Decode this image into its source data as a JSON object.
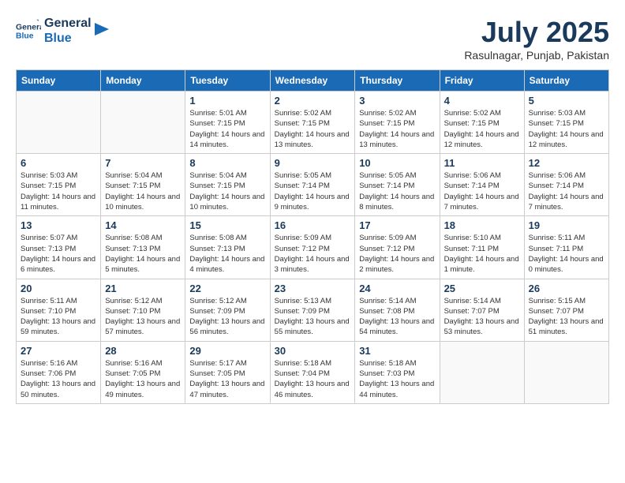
{
  "header": {
    "logo_general": "General",
    "logo_blue": "Blue",
    "month": "July 2025",
    "location": "Rasulnagar, Punjab, Pakistan"
  },
  "weekdays": [
    "Sunday",
    "Monday",
    "Tuesday",
    "Wednesday",
    "Thursday",
    "Friday",
    "Saturday"
  ],
  "weeks": [
    [
      {
        "day": null
      },
      {
        "day": null
      },
      {
        "day": 1,
        "sunrise": "Sunrise: 5:01 AM",
        "sunset": "Sunset: 7:15 PM",
        "daylight": "Daylight: 14 hours and 14 minutes."
      },
      {
        "day": 2,
        "sunrise": "Sunrise: 5:02 AM",
        "sunset": "Sunset: 7:15 PM",
        "daylight": "Daylight: 14 hours and 13 minutes."
      },
      {
        "day": 3,
        "sunrise": "Sunrise: 5:02 AM",
        "sunset": "Sunset: 7:15 PM",
        "daylight": "Daylight: 14 hours and 13 minutes."
      },
      {
        "day": 4,
        "sunrise": "Sunrise: 5:02 AM",
        "sunset": "Sunset: 7:15 PM",
        "daylight": "Daylight: 14 hours and 12 minutes."
      },
      {
        "day": 5,
        "sunrise": "Sunrise: 5:03 AM",
        "sunset": "Sunset: 7:15 PM",
        "daylight": "Daylight: 14 hours and 12 minutes."
      }
    ],
    [
      {
        "day": 6,
        "sunrise": "Sunrise: 5:03 AM",
        "sunset": "Sunset: 7:15 PM",
        "daylight": "Daylight: 14 hours and 11 minutes."
      },
      {
        "day": 7,
        "sunrise": "Sunrise: 5:04 AM",
        "sunset": "Sunset: 7:15 PM",
        "daylight": "Daylight: 14 hours and 10 minutes."
      },
      {
        "day": 8,
        "sunrise": "Sunrise: 5:04 AM",
        "sunset": "Sunset: 7:15 PM",
        "daylight": "Daylight: 14 hours and 10 minutes."
      },
      {
        "day": 9,
        "sunrise": "Sunrise: 5:05 AM",
        "sunset": "Sunset: 7:14 PM",
        "daylight": "Daylight: 14 hours and 9 minutes."
      },
      {
        "day": 10,
        "sunrise": "Sunrise: 5:05 AM",
        "sunset": "Sunset: 7:14 PM",
        "daylight": "Daylight: 14 hours and 8 minutes."
      },
      {
        "day": 11,
        "sunrise": "Sunrise: 5:06 AM",
        "sunset": "Sunset: 7:14 PM",
        "daylight": "Daylight: 14 hours and 7 minutes."
      },
      {
        "day": 12,
        "sunrise": "Sunrise: 5:06 AM",
        "sunset": "Sunset: 7:14 PM",
        "daylight": "Daylight: 14 hours and 7 minutes."
      }
    ],
    [
      {
        "day": 13,
        "sunrise": "Sunrise: 5:07 AM",
        "sunset": "Sunset: 7:13 PM",
        "daylight": "Daylight: 14 hours and 6 minutes."
      },
      {
        "day": 14,
        "sunrise": "Sunrise: 5:08 AM",
        "sunset": "Sunset: 7:13 PM",
        "daylight": "Daylight: 14 hours and 5 minutes."
      },
      {
        "day": 15,
        "sunrise": "Sunrise: 5:08 AM",
        "sunset": "Sunset: 7:13 PM",
        "daylight": "Daylight: 14 hours and 4 minutes."
      },
      {
        "day": 16,
        "sunrise": "Sunrise: 5:09 AM",
        "sunset": "Sunset: 7:12 PM",
        "daylight": "Daylight: 14 hours and 3 minutes."
      },
      {
        "day": 17,
        "sunrise": "Sunrise: 5:09 AM",
        "sunset": "Sunset: 7:12 PM",
        "daylight": "Daylight: 14 hours and 2 minutes."
      },
      {
        "day": 18,
        "sunrise": "Sunrise: 5:10 AM",
        "sunset": "Sunset: 7:11 PM",
        "daylight": "Daylight: 14 hours and 1 minute."
      },
      {
        "day": 19,
        "sunrise": "Sunrise: 5:11 AM",
        "sunset": "Sunset: 7:11 PM",
        "daylight": "Daylight: 14 hours and 0 minutes."
      }
    ],
    [
      {
        "day": 20,
        "sunrise": "Sunrise: 5:11 AM",
        "sunset": "Sunset: 7:10 PM",
        "daylight": "Daylight: 13 hours and 59 minutes."
      },
      {
        "day": 21,
        "sunrise": "Sunrise: 5:12 AM",
        "sunset": "Sunset: 7:10 PM",
        "daylight": "Daylight: 13 hours and 57 minutes."
      },
      {
        "day": 22,
        "sunrise": "Sunrise: 5:12 AM",
        "sunset": "Sunset: 7:09 PM",
        "daylight": "Daylight: 13 hours and 56 minutes."
      },
      {
        "day": 23,
        "sunrise": "Sunrise: 5:13 AM",
        "sunset": "Sunset: 7:09 PM",
        "daylight": "Daylight: 13 hours and 55 minutes."
      },
      {
        "day": 24,
        "sunrise": "Sunrise: 5:14 AM",
        "sunset": "Sunset: 7:08 PM",
        "daylight": "Daylight: 13 hours and 54 minutes."
      },
      {
        "day": 25,
        "sunrise": "Sunrise: 5:14 AM",
        "sunset": "Sunset: 7:07 PM",
        "daylight": "Daylight: 13 hours and 53 minutes."
      },
      {
        "day": 26,
        "sunrise": "Sunrise: 5:15 AM",
        "sunset": "Sunset: 7:07 PM",
        "daylight": "Daylight: 13 hours and 51 minutes."
      }
    ],
    [
      {
        "day": 27,
        "sunrise": "Sunrise: 5:16 AM",
        "sunset": "Sunset: 7:06 PM",
        "daylight": "Daylight: 13 hours and 50 minutes."
      },
      {
        "day": 28,
        "sunrise": "Sunrise: 5:16 AM",
        "sunset": "Sunset: 7:05 PM",
        "daylight": "Daylight: 13 hours and 49 minutes."
      },
      {
        "day": 29,
        "sunrise": "Sunrise: 5:17 AM",
        "sunset": "Sunset: 7:05 PM",
        "daylight": "Daylight: 13 hours and 47 minutes."
      },
      {
        "day": 30,
        "sunrise": "Sunrise: 5:18 AM",
        "sunset": "Sunset: 7:04 PM",
        "daylight": "Daylight: 13 hours and 46 minutes."
      },
      {
        "day": 31,
        "sunrise": "Sunrise: 5:18 AM",
        "sunset": "Sunset: 7:03 PM",
        "daylight": "Daylight: 13 hours and 44 minutes."
      },
      {
        "day": null
      },
      {
        "day": null
      }
    ]
  ]
}
